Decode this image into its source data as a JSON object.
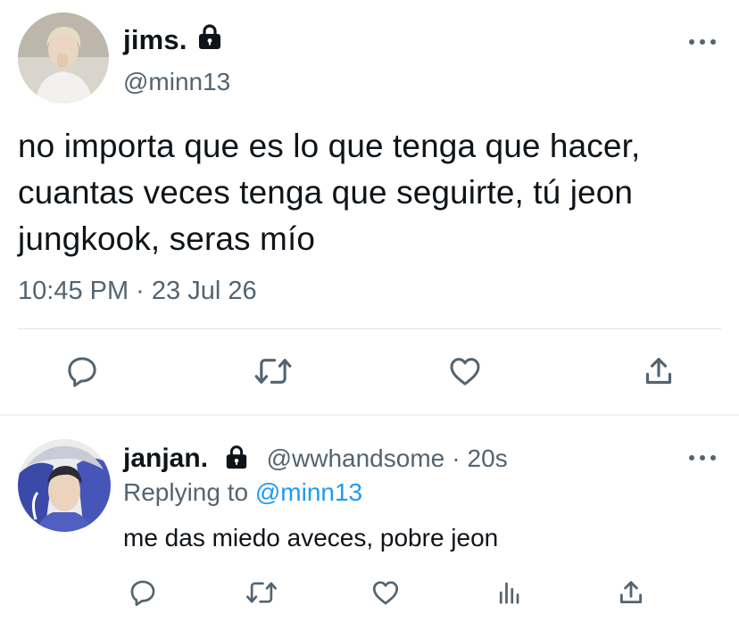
{
  "main_tweet": {
    "display_name": "jims.",
    "handle": "@minn13",
    "text": "no importa que es lo que tenga que hacer, cuantas veces tenga que seguirte, tú jeon jungkook, seras mío",
    "timestamp": "10:45 PM · 23 Jul 26",
    "actions": [
      "reply-icon",
      "retweet-icon",
      "like-icon",
      "share-icon"
    ]
  },
  "reply_tweet": {
    "display_name": "janjan.",
    "handle": "@wwhandsome",
    "separator": "·",
    "time_ago": "20s",
    "replying_prefix": "Replying to",
    "replying_to": "@minn13",
    "text": "me das miedo aveces, pobre jeon",
    "actions": [
      "reply-icon",
      "retweet-icon",
      "like-icon",
      "analytics-icon",
      "share-icon"
    ]
  },
  "colors": {
    "text_primary": "#0f1419",
    "text_secondary": "#536471",
    "accent": "#1d9bf0",
    "divider": "#e1e6ea"
  }
}
